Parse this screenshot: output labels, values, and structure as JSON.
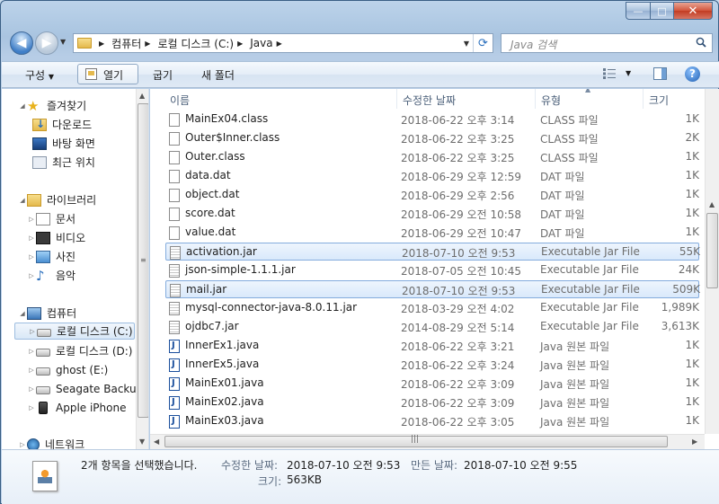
{
  "window": {
    "min_label": "—",
    "max_label": "□",
    "close_label": "✕"
  },
  "address": {
    "crumbs": [
      "컴퓨터",
      "로컬 디스크 (C:)",
      "Java"
    ],
    "search_placeholder": "Java 검색"
  },
  "toolbar": {
    "organize": "구성",
    "open": "열기",
    "share": "굽기",
    "new_folder": "새 폴더"
  },
  "nav": {
    "favorites": "즐겨찾기",
    "downloads": "다운로드",
    "desktop": "바탕 화면",
    "recent": "최근 위치",
    "libraries": "라이브러리",
    "documents": "문서",
    "videos": "비디오",
    "pictures": "사진",
    "music": "음악",
    "computer": "컴퓨터",
    "drive_c": "로컬 디스크 (C:)",
    "drive_d": "로컬 디스크 (D:)",
    "drive_e": "ghost (E:)",
    "seagate": "Seagate Backup",
    "iphone": "Apple iPhone",
    "network": "네트워크"
  },
  "columns": {
    "name": "이름",
    "date": "수정한 날짜",
    "type": "유형",
    "size": "크기"
  },
  "files": [
    {
      "name": "MainEx04.class",
      "date": "2018-06-22 오후 3:14",
      "type": "CLASS 파일",
      "size": "1K",
      "icon": "doc",
      "selected": false
    },
    {
      "name": "Outer$Inner.class",
      "date": "2018-06-22 오후 3:25",
      "type": "CLASS 파일",
      "size": "2K",
      "icon": "doc",
      "selected": false
    },
    {
      "name": "Outer.class",
      "date": "2018-06-22 오후 3:25",
      "type": "CLASS 파일",
      "size": "1K",
      "icon": "doc",
      "selected": false
    },
    {
      "name": "data.dat",
      "date": "2018-06-29 오후 12:59",
      "type": "DAT 파일",
      "size": "1K",
      "icon": "doc",
      "selected": false
    },
    {
      "name": "object.dat",
      "date": "2018-06-29 오후 2:56",
      "type": "DAT 파일",
      "size": "1K",
      "icon": "doc",
      "selected": false
    },
    {
      "name": "score.dat",
      "date": "2018-06-29 오전 10:58",
      "type": "DAT 파일",
      "size": "1K",
      "icon": "doc",
      "selected": false
    },
    {
      "name": "value.dat",
      "date": "2018-06-29 오전 10:47",
      "type": "DAT 파일",
      "size": "1K",
      "icon": "doc",
      "selected": false
    },
    {
      "name": "activation.jar",
      "date": "2018-07-10 오전 9:53",
      "type": "Executable Jar File",
      "size": "55K",
      "icon": "jar",
      "selected": true
    },
    {
      "name": "json-simple-1.1.1.jar",
      "date": "2018-07-05 오전 10:45",
      "type": "Executable Jar File",
      "size": "24K",
      "icon": "jar",
      "selected": false
    },
    {
      "name": "mail.jar",
      "date": "2018-07-10 오전 9:53",
      "type": "Executable Jar File",
      "size": "509K",
      "icon": "jar",
      "selected": true
    },
    {
      "name": "mysql-connector-java-8.0.11.jar",
      "date": "2018-03-29 오전 4:02",
      "type": "Executable Jar File",
      "size": "1,989K",
      "icon": "jar",
      "selected": false
    },
    {
      "name": "ojdbc7.jar",
      "date": "2014-08-29 오전 5:14",
      "type": "Executable Jar File",
      "size": "3,613K",
      "icon": "jar",
      "selected": false
    },
    {
      "name": "InnerEx1.java",
      "date": "2018-06-22 오후 3:21",
      "type": "Java 원본 파일",
      "size": "1K",
      "icon": "java",
      "selected": false
    },
    {
      "name": "InnerEx5.java",
      "date": "2018-06-22 오후 3:24",
      "type": "Java 원본 파일",
      "size": "1K",
      "icon": "java",
      "selected": false
    },
    {
      "name": "MainEx01.java",
      "date": "2018-06-22 오후 3:09",
      "type": "Java 원본 파일",
      "size": "1K",
      "icon": "java",
      "selected": false
    },
    {
      "name": "MainEx02.java",
      "date": "2018-06-22 오후 3:09",
      "type": "Java 원본 파일",
      "size": "1K",
      "icon": "java",
      "selected": false
    },
    {
      "name": "MainEx03.java",
      "date": "2018-06-22 오후 3:05",
      "type": "Java 원본 파일",
      "size": "1K",
      "icon": "java",
      "selected": false
    }
  ],
  "details": {
    "summary": "2개 항목을 선택했습니다.",
    "modified_label": "수정한 날짜:",
    "modified_value": "2018-07-10 오전 9:53",
    "created_label": "만든 날짜:",
    "created_value": "2018-07-10 오전 9:55",
    "size_label": "크기:",
    "size_value": "563KB"
  },
  "colors": {
    "selection": "#d9e9fb",
    "selection_border": "#84acdd",
    "frame": "#a9c4e0"
  }
}
